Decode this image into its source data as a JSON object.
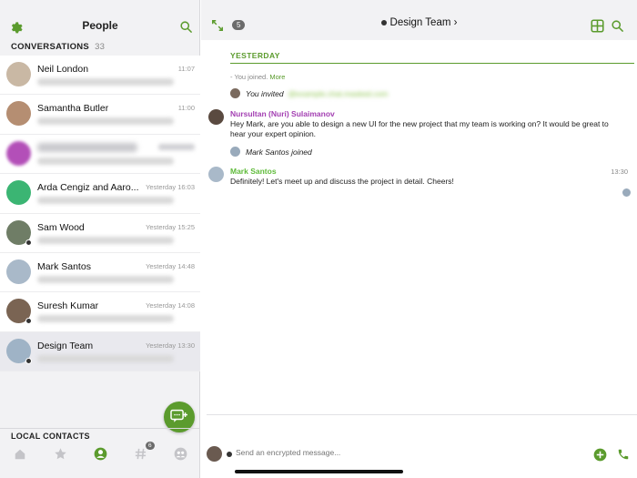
{
  "left_panel": {
    "title": "People",
    "conversations_label": "CONVERSATIONS",
    "conversations_count": "33",
    "local_contacts_label": "LOCAL CONTACTS",
    "tab_badge": "6"
  },
  "conversations": [
    {
      "name": "Neil London",
      "time": "11:07",
      "avatar_color": "#c9b8a4",
      "presence": false,
      "blur_name": false
    },
    {
      "name": "Samantha Butler",
      "time": "11:00",
      "avatar_color": "#b58e72",
      "presence": false,
      "blur_name": false
    },
    {
      "name": "",
      "time": "",
      "avatar_color": "#b34fb8",
      "presence": false,
      "blur_name": true
    },
    {
      "name": "Arda Cengiz and Aaro...",
      "time": "Yesterday 16:03",
      "avatar_color": "#3bb573",
      "presence": false,
      "blur_name": false
    },
    {
      "name": "Sam Wood",
      "time": "Yesterday 15:25",
      "avatar_color": "#6f7d66",
      "presence": true,
      "blur_name": false
    },
    {
      "name": "Mark Santos",
      "time": "Yesterday 14:48",
      "avatar_color": "#a9b9c9",
      "presence": false,
      "blur_name": false
    },
    {
      "name": "Suresh Kumar",
      "time": "Yesterday 14:08",
      "avatar_color": "#7a6453",
      "presence": true,
      "blur_name": false
    },
    {
      "name": "Design Team",
      "time": "Yesterday 13:30",
      "avatar_color": "#9fb3c6",
      "presence": true,
      "blur_name": false
    }
  ],
  "chat": {
    "header_badge": "5",
    "title": "Design Team",
    "date_separator": "YESTERDAY",
    "system_joined": "- You joined.",
    "system_more": "More",
    "invited_text": "You invited",
    "message1": {
      "sender": "Nursultan (Nuri) Sulaimanov",
      "text": "Hey Mark, are you able to design a new UI for the new project that my team is working on? It would be great to hear your expert opinion.",
      "sender_color": "#a33fb2"
    },
    "joined_text": "Mark Santos joined",
    "message2": {
      "sender": "Mark Santos",
      "text": "Definitely! Let's meet up and discuss the project in detail. Cheers!",
      "time": "13:30",
      "sender_color": "#5fbb3a"
    },
    "composer_placeholder": "Send an encrypted message..."
  },
  "colors": {
    "accent": "#5b9b2d"
  }
}
